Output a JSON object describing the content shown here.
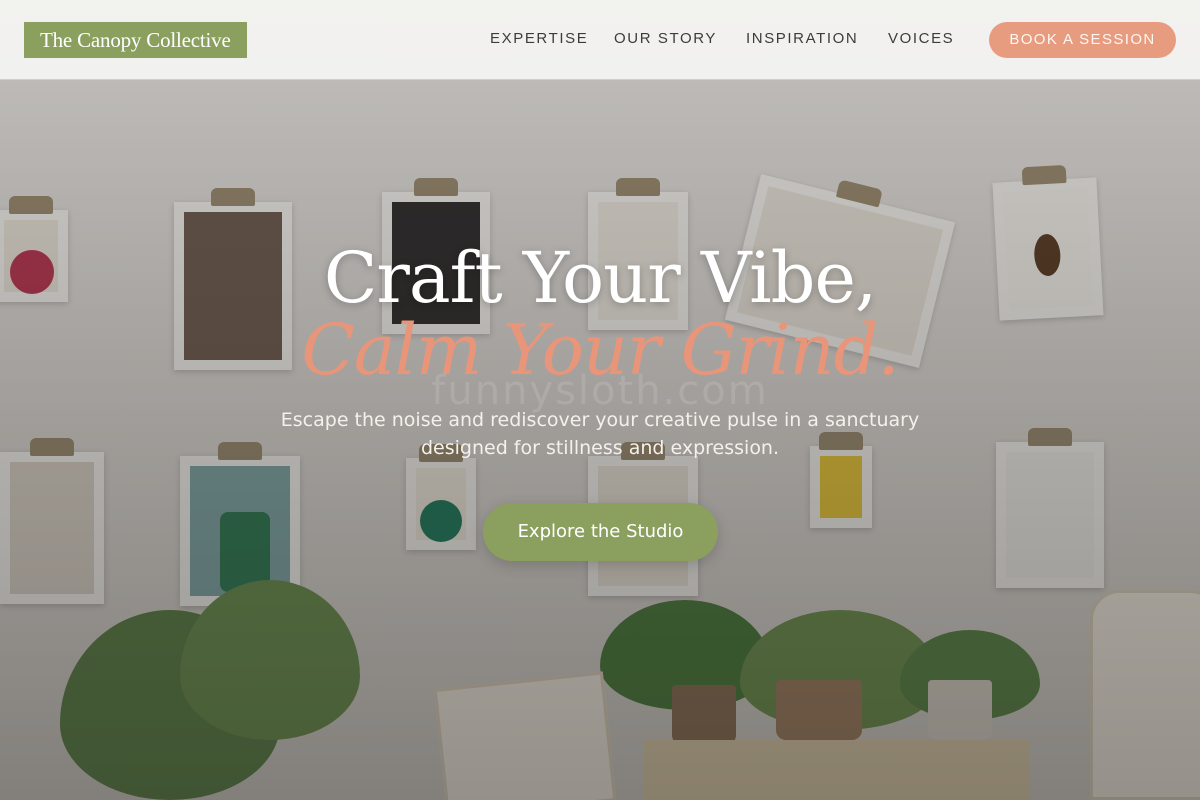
{
  "brand": {
    "name": "The Canopy Collective",
    "accent_green": "#8ba05e",
    "accent_coral": "#e79c80"
  },
  "nav": {
    "items": [
      {
        "label": "EXPERTISE"
      },
      {
        "label": "OUR STORY"
      },
      {
        "label": "INSPIRATION"
      },
      {
        "label": "VOICES"
      }
    ],
    "cta_label": "BOOK A SESSION"
  },
  "hero": {
    "headline_line1": "Craft Your Vibe,",
    "headline_line2": "Calm Your Grind.",
    "subtitle": "Escape the noise and rediscover your creative pulse in a sanctuary designed for stillness and expression.",
    "button_label": "Explore the Studio",
    "watermark": "funnysloth.com"
  }
}
